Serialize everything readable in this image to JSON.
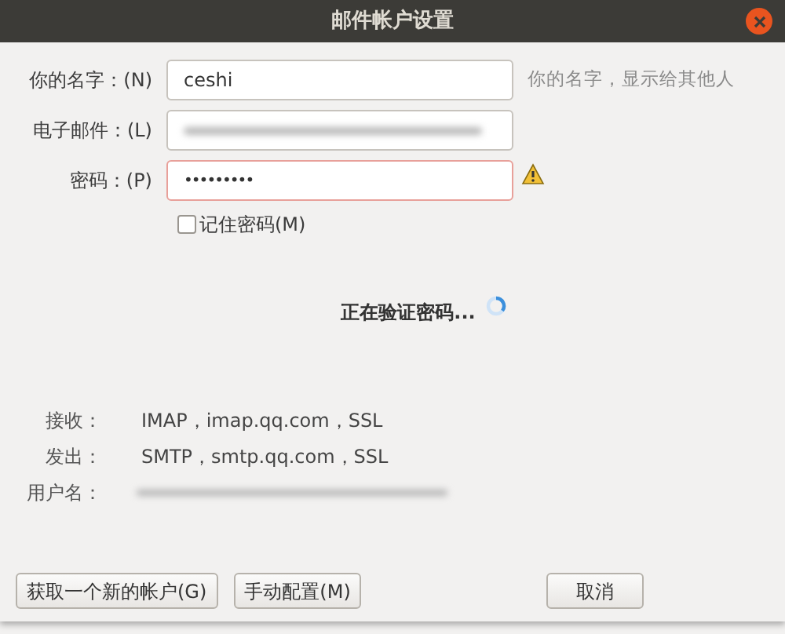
{
  "window": {
    "title": "邮件帐户设置"
  },
  "fields": [
    {
      "kind": "text",
      "label": "你的名字：(N)",
      "value": "ceshi",
      "hint": "你的名字，显示给其他人"
    },
    {
      "kind": "redacted",
      "label": "电子邮件：(L)"
    },
    {
      "kind": "password",
      "label": "密码：(P)",
      "value": "•••••••••",
      "invalid": true
    }
  ],
  "remember_password": {
    "label": "记住密码(M)",
    "checked": false
  },
  "status": {
    "text": "正在验证密码...",
    "busy": true
  },
  "settings": [
    {
      "label": "接收：",
      "value": "IMAP，imap.qq.com，SSL"
    },
    {
      "label": "发出：",
      "value": "SMTP，smtp.qq.com，SSL"
    },
    {
      "label": "用户名：",
      "redacted": true
    }
  ],
  "buttons": [
    {
      "label": "获取一个新的帐户(G)"
    },
    {
      "label": "手动配置(M)"
    },
    {
      "label": "取消"
    }
  ]
}
